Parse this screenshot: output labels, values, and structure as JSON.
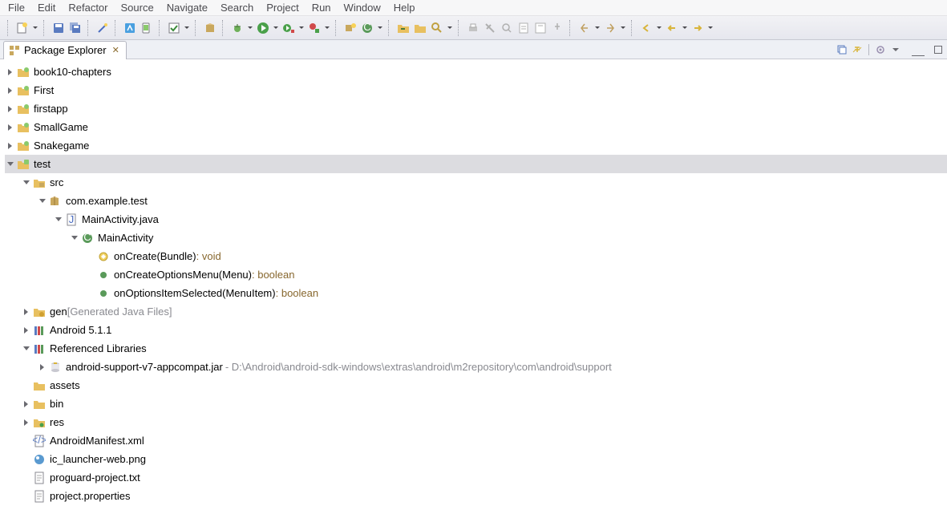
{
  "menu": [
    "File",
    "Edit",
    "Refactor",
    "Source",
    "Navigate",
    "Search",
    "Project",
    "Run",
    "Window",
    "Help"
  ],
  "viewtab": {
    "title": "Package Explorer"
  },
  "tree": [
    {
      "d": 0,
      "t": "closed",
      "ic": "project",
      "label": "book10-chapters"
    },
    {
      "d": 0,
      "t": "closed",
      "ic": "project",
      "label": "First"
    },
    {
      "d": 0,
      "t": "closed",
      "ic": "project",
      "label": "firstapp"
    },
    {
      "d": 0,
      "t": "closed",
      "ic": "project",
      "label": "SmallGame"
    },
    {
      "d": 0,
      "t": "closed",
      "ic": "project",
      "label": "Snakegame"
    },
    {
      "d": 0,
      "t": "open",
      "ic": "android",
      "label": "test",
      "sel": true
    },
    {
      "d": 1,
      "t": "open",
      "ic": "srcfolder",
      "label": "src"
    },
    {
      "d": 2,
      "t": "open",
      "ic": "package",
      "label": "com.example.test"
    },
    {
      "d": 3,
      "t": "open",
      "ic": "javafile",
      "label": "MainActivity.java"
    },
    {
      "d": 4,
      "t": "open",
      "ic": "class",
      "label": "MainActivity"
    },
    {
      "d": 5,
      "t": "none",
      "ic": "method-o",
      "label": "onCreate(Bundle)",
      "suffix": " : void"
    },
    {
      "d": 5,
      "t": "none",
      "ic": "method-p",
      "label": "onCreateOptionsMenu(Menu)",
      "suffix": " : boolean"
    },
    {
      "d": 5,
      "t": "none",
      "ic": "method-p",
      "label": "onOptionsItemSelected(MenuItem)",
      "suffix": " : boolean"
    },
    {
      "d": 1,
      "t": "closed",
      "ic": "genfolder",
      "label": "gen",
      "suffixgray": " [Generated Java Files]"
    },
    {
      "d": 1,
      "t": "closed",
      "ic": "library",
      "label": "Android 5.1.1"
    },
    {
      "d": 1,
      "t": "open",
      "ic": "library",
      "label": "Referenced Libraries"
    },
    {
      "d": 2,
      "t": "closed",
      "ic": "jar",
      "label": "android-support-v7-appcompat.jar",
      "extra": " - D:\\Android\\android-sdk-windows\\extras\\android\\m2repository\\com\\android\\support"
    },
    {
      "d": 1,
      "t": "none",
      "ic": "folder",
      "label": "assets"
    },
    {
      "d": 1,
      "t": "closed",
      "ic": "folder",
      "label": "bin"
    },
    {
      "d": 1,
      "t": "closed",
      "ic": "resfolder",
      "label": "res"
    },
    {
      "d": 1,
      "t": "none",
      "ic": "xml",
      "label": "AndroidManifest.xml"
    },
    {
      "d": 1,
      "t": "none",
      "ic": "image",
      "label": "ic_launcher-web.png"
    },
    {
      "d": 1,
      "t": "none",
      "ic": "text",
      "label": "proguard-project.txt"
    },
    {
      "d": 1,
      "t": "none",
      "ic": "text",
      "label": "project.properties"
    }
  ]
}
